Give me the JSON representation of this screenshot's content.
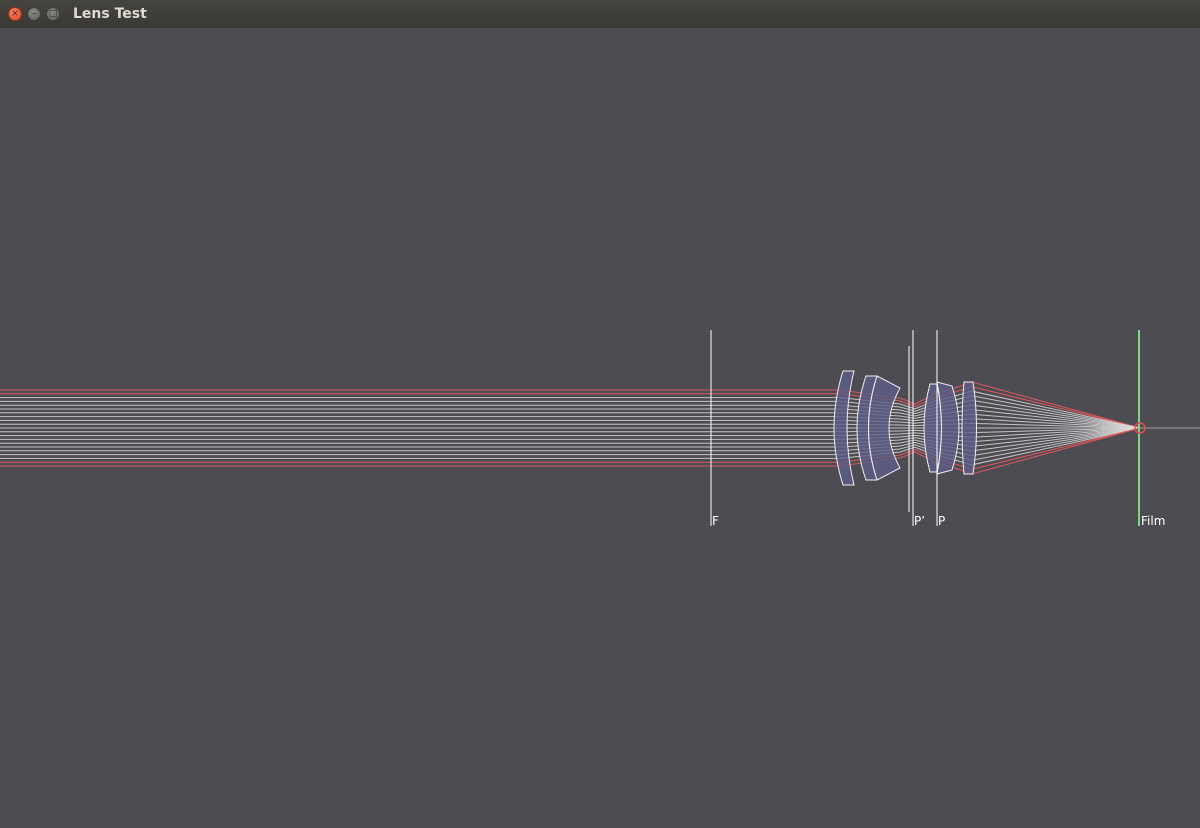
{
  "window": {
    "title": "Lens Test",
    "close_glyph": "×",
    "minimize_glyph": "–",
    "maximize_glyph": "□"
  },
  "diagram": {
    "focal_label": "F",
    "principal_prime_label": "P’",
    "principal_label": "P",
    "film_label": "Film",
    "colors": {
      "background": "#4d4c53",
      "ray": "#d9d9d9",
      "marginal_ray": "#e05a5a",
      "lens_fill": "#5d5e8a",
      "lens_edge": "#f0f0f0",
      "film": "#7ed67e",
      "focus_marker": "#e05050"
    }
  }
}
